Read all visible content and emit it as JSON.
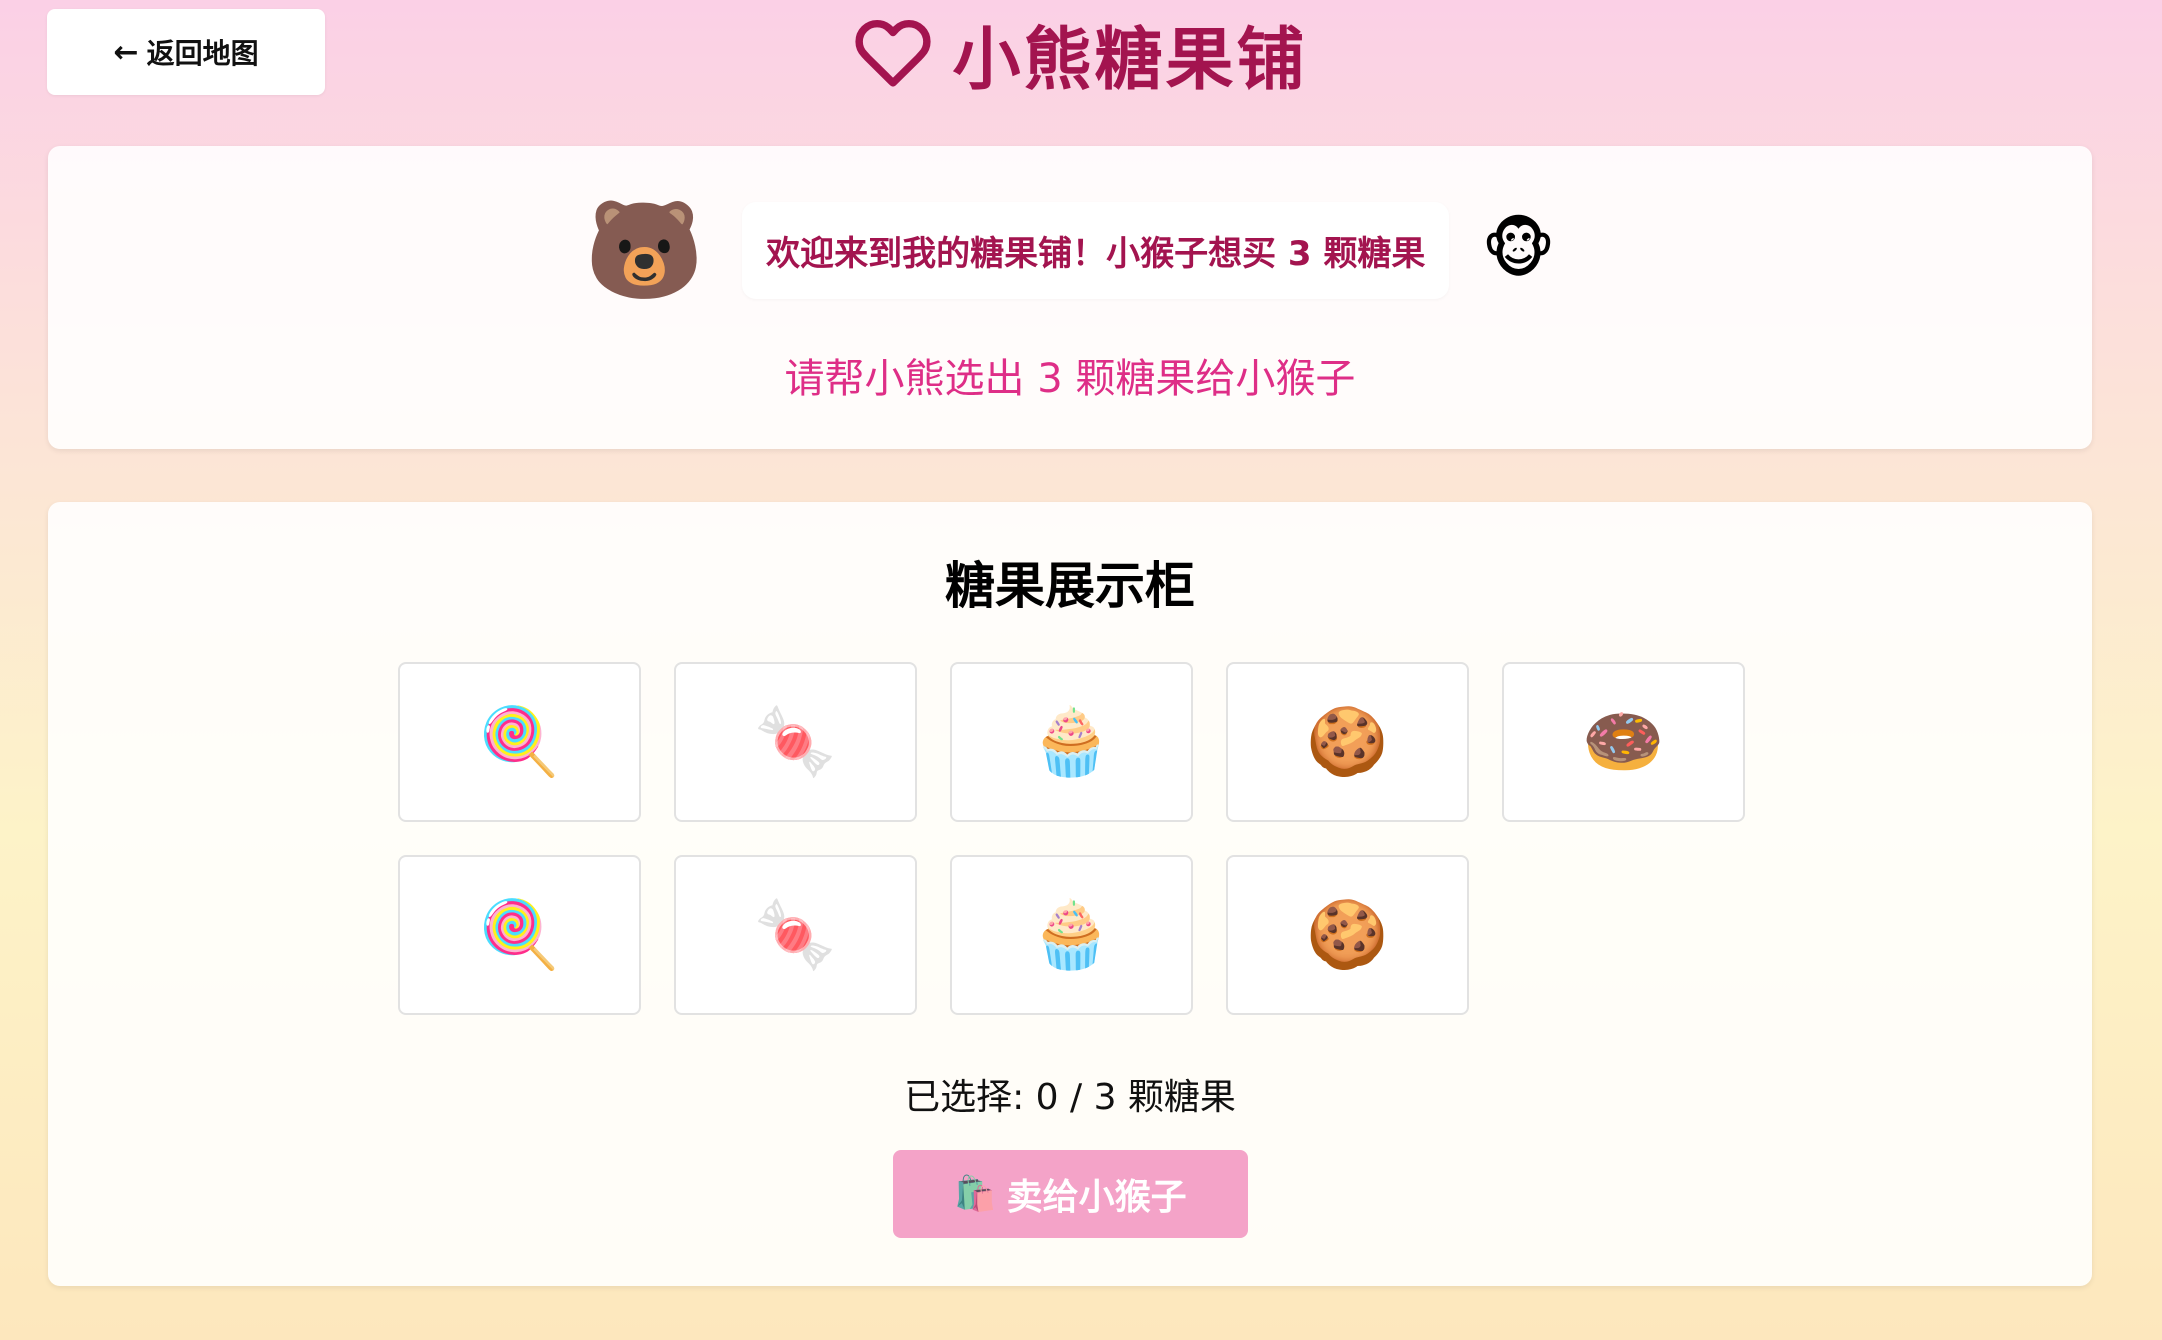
{
  "nav": {
    "back_arrow": "←",
    "back_label": "返回地图"
  },
  "header": {
    "title": "小熊糖果铺",
    "icon": "heart-outline-icon",
    "accent_color": "#a3144f"
  },
  "intro": {
    "bear_emoji": "🐻",
    "message": "欢迎来到我的糖果铺！小猴子想买 3 颗糖果",
    "monkey_emoji": "🐵",
    "instruction": "请帮小熊选出 3 颗糖果给小猴子",
    "instruction_color": "#de2e87"
  },
  "shop": {
    "title": "糖果展示柜",
    "candies": [
      {
        "name": "lollipop",
        "emoji": "🍭"
      },
      {
        "name": "candy",
        "emoji": "🍬"
      },
      {
        "name": "cupcake",
        "emoji": "🧁"
      },
      {
        "name": "cookie",
        "emoji": "🍪"
      },
      {
        "name": "donut",
        "emoji": "🍩"
      },
      {
        "name": "lollipop",
        "emoji": "🍭"
      },
      {
        "name": "candy",
        "emoji": "🍬"
      },
      {
        "name": "cupcake",
        "emoji": "🧁"
      },
      {
        "name": "cookie",
        "emoji": "🍪"
      }
    ],
    "selection_text": "已选择: 0 / 3 颗糖果",
    "sell_icon": "🛍️",
    "sell_label": "卖给小猴子",
    "sell_button_color": "#f4a3c8"
  }
}
